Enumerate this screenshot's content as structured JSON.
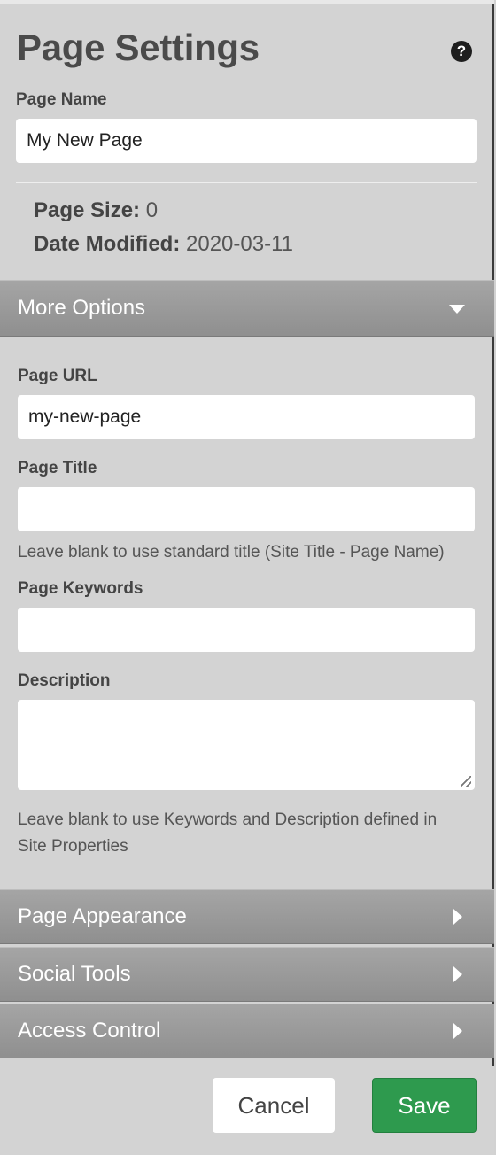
{
  "header": {
    "title": "Page Settings",
    "help_icon": "?"
  },
  "page_name": {
    "label": "Page Name",
    "value": "My New Page"
  },
  "info": {
    "page_size_label": "Page Size:",
    "page_size_value": "0",
    "date_modified_label": "Date Modified:",
    "date_modified_value": "2020-03-11"
  },
  "more_options": {
    "title": "More Options",
    "page_url": {
      "label": "Page URL",
      "value": "my-new-page"
    },
    "page_title": {
      "label": "Page Title",
      "value": "",
      "hint": "Leave blank to use standard title (Site Title - Page Name)"
    },
    "page_keywords": {
      "label": "Page Keywords",
      "value": ""
    },
    "description": {
      "label": "Description",
      "value": ""
    },
    "meta_hint_line1": "Leave blank to use Keywords and Description defined in",
    "meta_hint_line2": "Site Properties"
  },
  "sections": {
    "page_appearance": "Page Appearance",
    "social_tools": "Social Tools",
    "access_control": "Access Control"
  },
  "footer": {
    "cancel_label": "Cancel",
    "save_label": "Save"
  },
  "colors": {
    "save_button": "#2e9a4e",
    "section_header": "#999999",
    "panel_bg": "#d3d3d3"
  }
}
